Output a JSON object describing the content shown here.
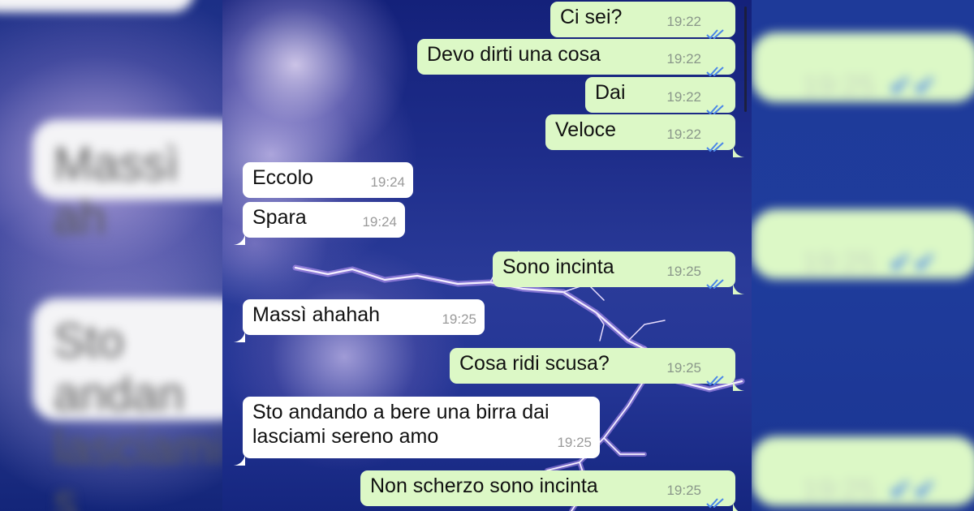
{
  "messages": [
    {
      "direction": "out",
      "text": "Ci sei?",
      "time": "19:22",
      "status": "read"
    },
    {
      "direction": "out",
      "text": "Devo dirti una cosa",
      "time": "19:22",
      "status": "read"
    },
    {
      "direction": "out",
      "text": "Dai",
      "time": "19:22",
      "status": "read"
    },
    {
      "direction": "out",
      "text": "Veloce",
      "time": "19:22",
      "status": "read"
    },
    {
      "direction": "in",
      "text": "Eccolo",
      "time": "19:24"
    },
    {
      "direction": "in",
      "text": "Spara",
      "time": "19:24"
    },
    {
      "direction": "out",
      "text": "Sono incinta",
      "time": "19:25",
      "status": "read"
    },
    {
      "direction": "in",
      "text": "Massì ahahah",
      "time": "19:25"
    },
    {
      "direction": "out",
      "text": "Cosa ridi scusa?",
      "time": "19:25",
      "status": "read"
    },
    {
      "direction": "in",
      "text": "Sto andando a bere una birra dai\nlasciami sereno amo",
      "time": "19:25"
    },
    {
      "direction": "out",
      "text": "Non scherzo sono incinta",
      "time": "19:25",
      "status": "read"
    }
  ],
  "blurred_left": {
    "fragment_1": "Massì ah",
    "fragment_2": "Sto andan",
    "fragment_3": "lasciami s"
  },
  "blurred_right": {
    "time": "19:25"
  },
  "colors": {
    "outgoing_bubble": "#dcf8c6",
    "incoming_bubble": "#ffffff",
    "read_ticks": "#4a86e8",
    "time_text": "#8a978a"
  },
  "icons": {
    "read_receipt": "double-check-icon"
  }
}
